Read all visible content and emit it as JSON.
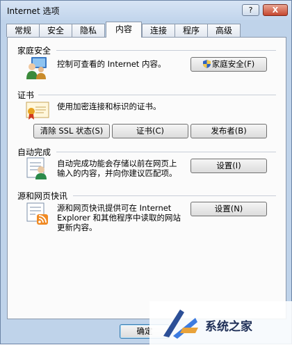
{
  "window": {
    "title": "Internet 选项",
    "help_btn": "?",
    "close_btn": "X"
  },
  "tabs": [
    {
      "label": "常规"
    },
    {
      "label": "安全"
    },
    {
      "label": "隐私"
    },
    {
      "label": "内容",
      "active": true
    },
    {
      "label": "连接"
    },
    {
      "label": "程序"
    },
    {
      "label": "高级"
    }
  ],
  "family_safety": {
    "title": "家庭安全",
    "description": "控制可查看的 Internet 内容。",
    "button": "家庭安全(F)"
  },
  "certificates": {
    "title": "证书",
    "description": "使用加密连接和标识的证书。",
    "buttons": {
      "clear_ssl": "清除 SSL 状态(S)",
      "certificates": "证书(C)",
      "publishers": "发布者(B)"
    }
  },
  "autocomplete": {
    "title": "自动完成",
    "description_lines": [
      "自动完成功能会存储以前在网页上",
      "输入的内容，并向你建议匹配项。"
    ],
    "button": "设置(I)"
  },
  "feeds": {
    "title": "源和网页快讯",
    "description_lines": [
      "源和网页快讯提供可在 Internet",
      "Explorer 和其他程序中读取的网站",
      "更新内容。"
    ],
    "button": "设置(N)"
  },
  "footer": {
    "ok_button": "确定"
  },
  "watermark": {
    "text": "系统之家"
  }
}
